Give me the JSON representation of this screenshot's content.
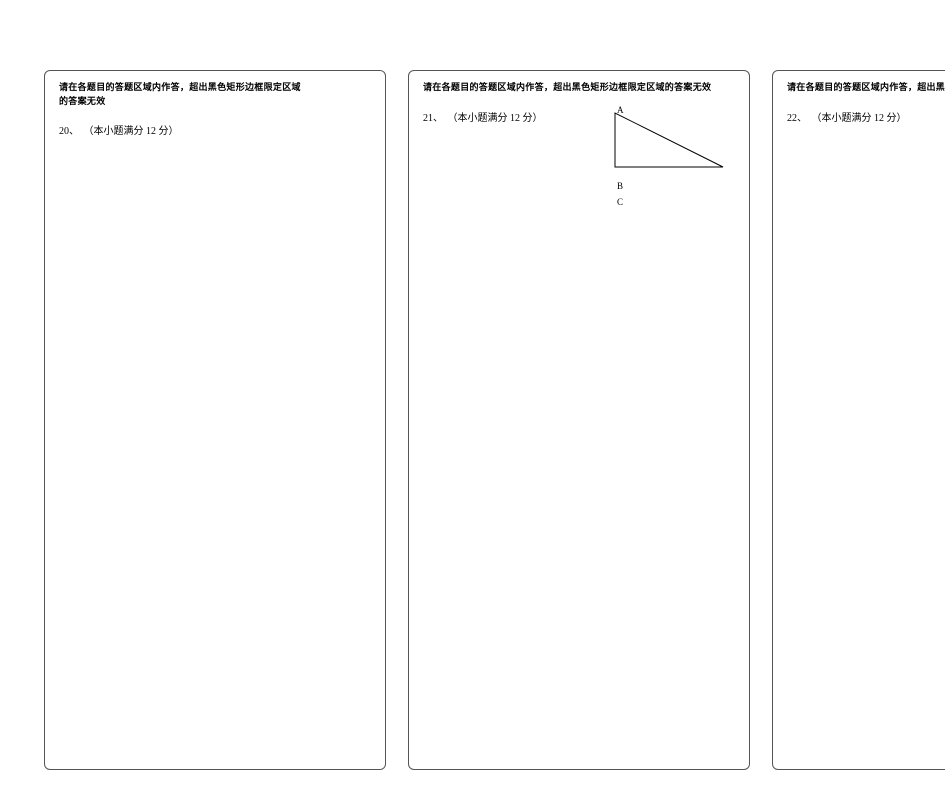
{
  "panels": [
    {
      "instruction_line1": "请在各题目的答题区域内作答，超出黑色矩形边框限定区域",
      "instruction_line2": "的答案无效",
      "question_number": "20、",
      "question_text": "（本小题满分  12 分）"
    },
    {
      "instruction_line1": "请在各题目的答题区域内作答，超出黑色矩形边框限定区域的答案无效",
      "instruction_line2": "",
      "question_number": "21、",
      "question_text": "（本小题满分  12 分）",
      "diagram": {
        "vertex_a": "A",
        "vertex_b": "B",
        "vertex_c": "C"
      }
    },
    {
      "instruction_line1": "请在各题目的答题区域内作答，超出黑色矩形边框限定区域的答案无效",
      "instruction_line2": "",
      "question_number": "22、",
      "question_text": "（本小题满分  12 分）"
    }
  ]
}
